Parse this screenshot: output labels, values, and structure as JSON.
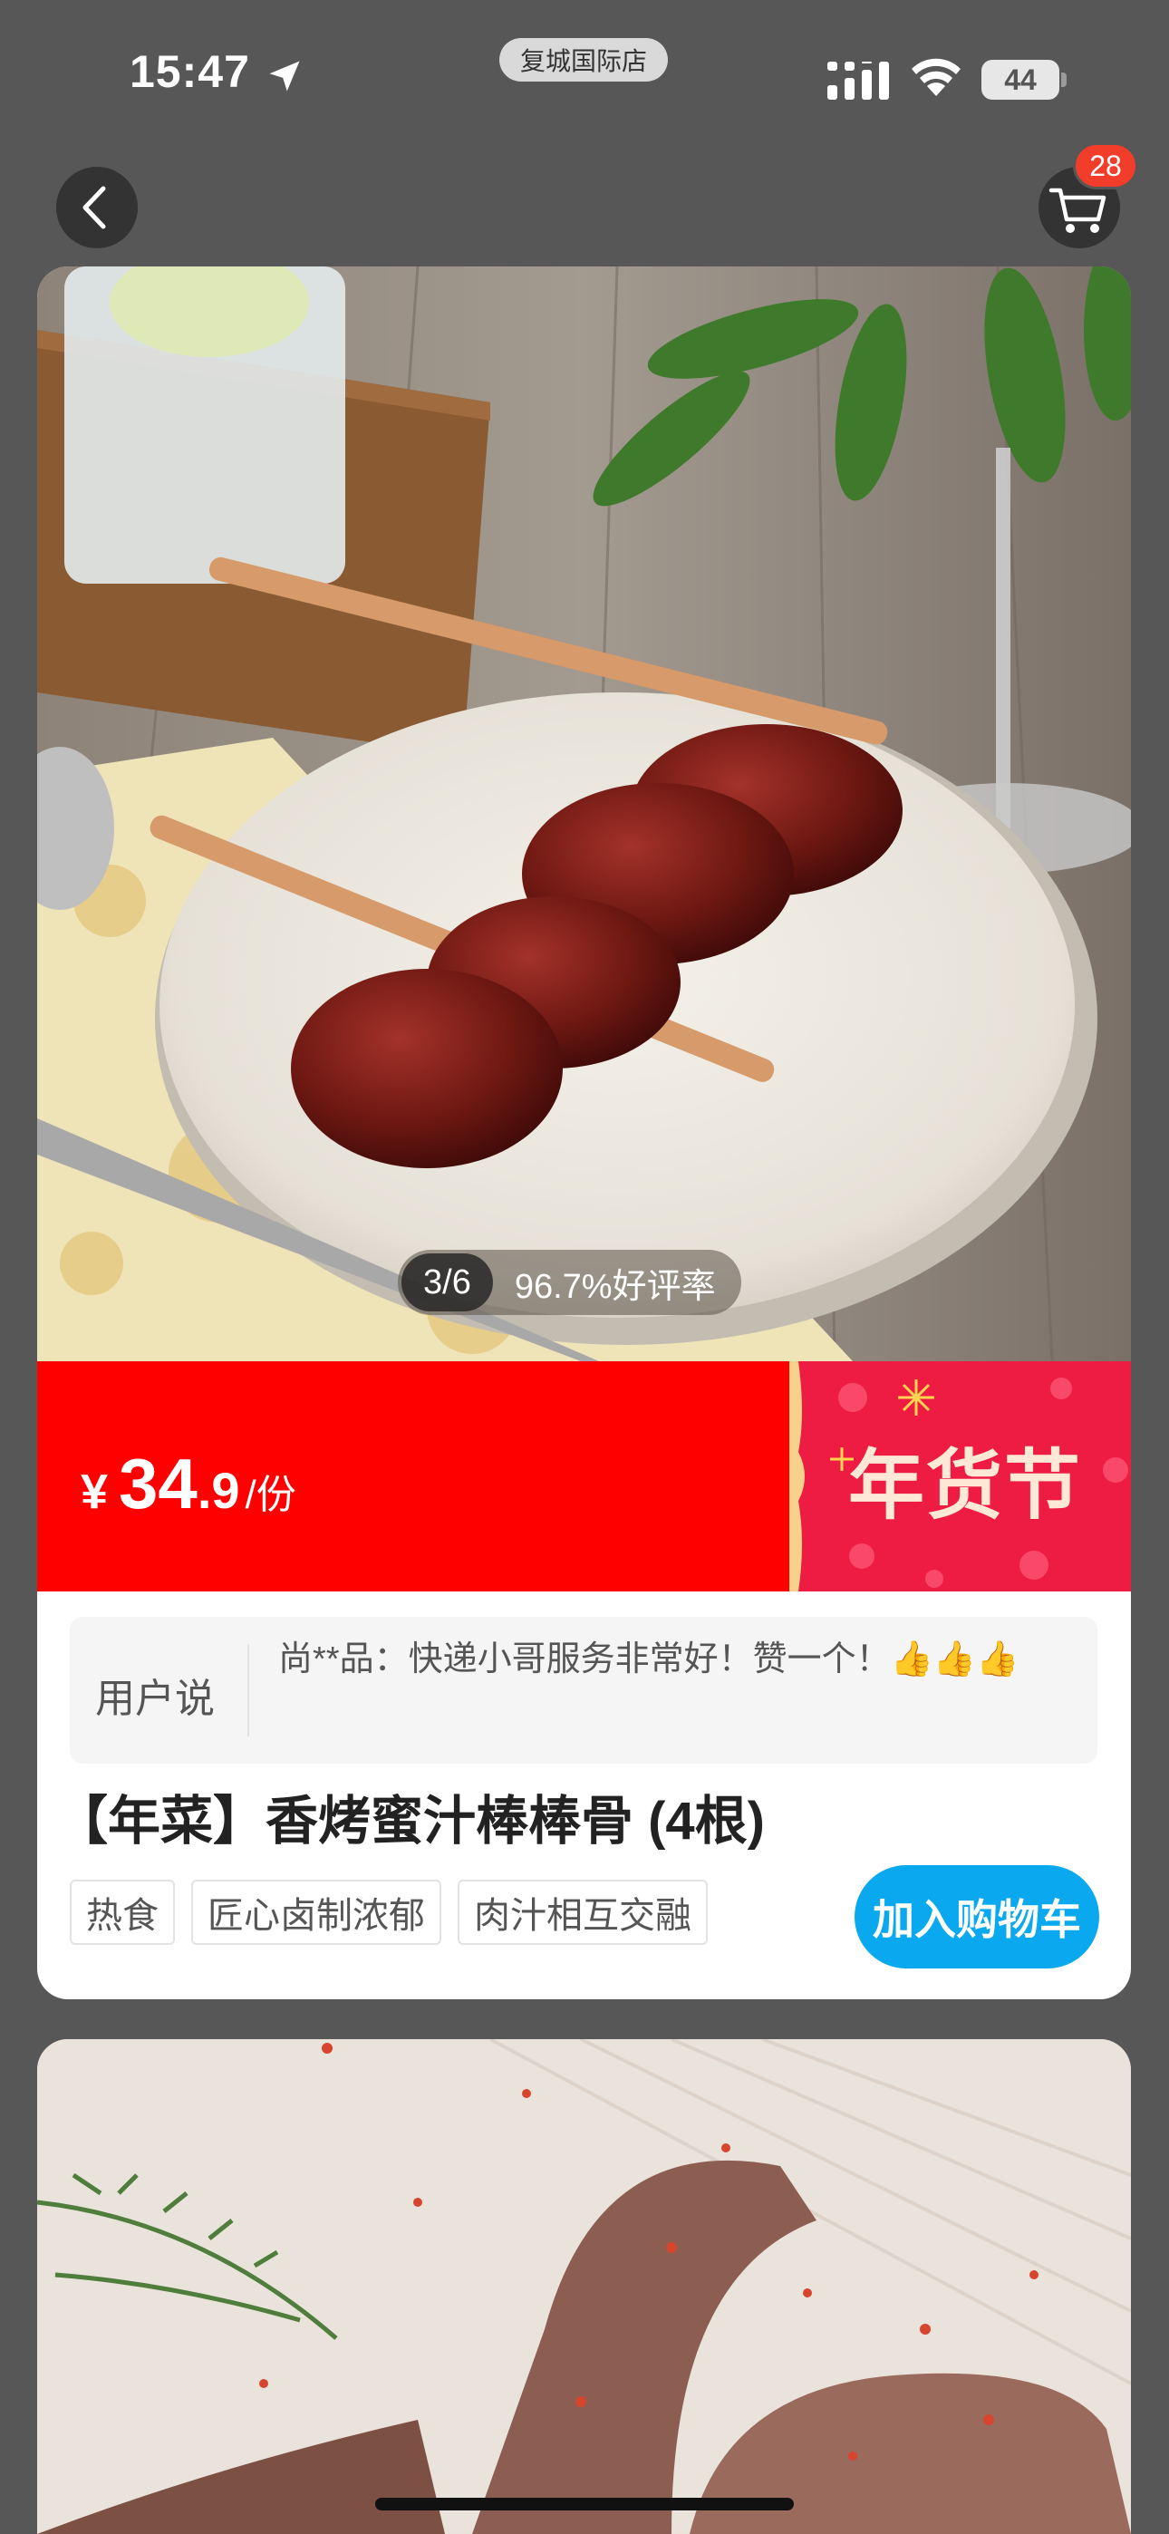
{
  "status_bar": {
    "time": "15:47",
    "store": "复城国际店",
    "battery": "44"
  },
  "nav": {
    "back_icon": "chevron-left-icon",
    "cart_icon": "shopping-cart-icon",
    "cart_count": "28"
  },
  "product": {
    "image_index": "3/6",
    "rating": "96.7%好评率",
    "price_symbol": "¥",
    "price_int": "34",
    "price_dec": ".9",
    "price_unit": "/份",
    "promo_banner": "年货节",
    "review_label": "用户说",
    "review_text": "尚**品：快递小哥服务非常好！赞一个！👍👍👍",
    "title": "【年菜】香烤蜜汁棒棒骨 (4根)",
    "tags": [
      "热食",
      "匠心卤制浓郁",
      "肉汁相互交融"
    ],
    "add_to_cart": "加入购物车"
  },
  "colors": {
    "price_bar": "#ff0000",
    "button": "#0aa8ef",
    "badge": "#f23d2b",
    "background": "#575757"
  }
}
